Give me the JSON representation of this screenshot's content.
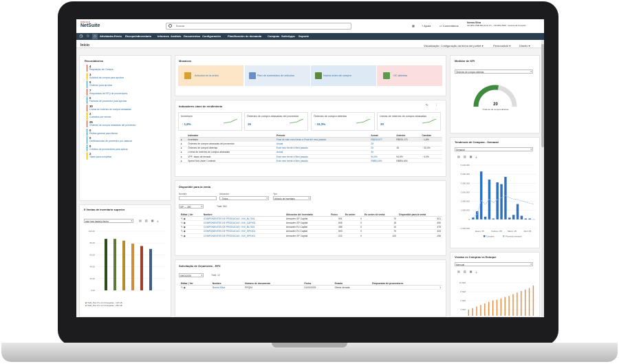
{
  "brand": {
    "oracle": "ORACLE",
    "netsuite": "NetSuite"
  },
  "search": {
    "placeholder": "Buscar"
  },
  "top_right": {
    "help": "Ajuda",
    "comments": "Comentários",
    "user_name": "Norma Silva",
    "user_detail_1": "CD MPG PRM BR (24.2) 3.5 – CD MPG PRM - Gerente de Compras"
  },
  "nav": [
    "Atividades",
    "Envio",
    "Recepción",
    "Inventario",
    "Informes",
    "Análisis",
    "Documentos",
    "Configuración",
    "Planificación de demanda",
    "Compras",
    "SuiteApps",
    "Soporte"
  ],
  "page": {
    "title": "Início",
    "view_label": "Visualização: Configuração da fecha del portlet",
    "personalize": "Personalizar",
    "layout": "Diseño"
  },
  "reminders": {
    "title": "Recordatorios",
    "items": [
      {
        "n": "4",
        "t": "Requisição de Compra",
        "c": "r"
      },
      {
        "n": "3",
        "t": "Solicitud de compra para aprobar",
        "c": "g"
      },
      {
        "n": "0",
        "t": "Órdenes para aprobar",
        "c": "b"
      },
      {
        "n": "7",
        "t": "Respuestas de RFQ de proveedores",
        "c": "r"
      },
      {
        "n": "0",
        "t": "Facturas de proveedor para aprobar",
        "c": "b"
      },
      {
        "n": "30",
        "t": "Líneas de órdenes de compra atrasadas",
        "c": "r"
      },
      {
        "n": "2",
        "t": "Contratos por vencer",
        "c": "g"
      },
      {
        "n": "25",
        "t": "Órdenes de compra atrasadas del proveedor",
        "c": "r"
      },
      {
        "n": "0",
        "t": "Pedido general para liberar",
        "c": "b"
      },
      {
        "n": "0",
        "t": "Certificaciones de proveedor por caducar",
        "c": "b"
      },
      {
        "n": "0",
        "t": "Créditos de proveedores para aplicar",
        "c": "b"
      },
      {
        "n": "2",
        "t": "Taxes para completar",
        "c": "g"
      }
    ]
  },
  "top_sales": {
    "title": "5 Ventas de inventario superior",
    "period": "este mes hasta la fecha",
    "legend": [
      "ITEM_Plan Pro 12.0 Polegadas - 128 GB",
      "ITEM_Plan Pro 12.0 Polegadas - 256 GB"
    ]
  },
  "chart_data": [
    {
      "type": "bar",
      "title": "5 Ventas de inventario superior",
      "ylim": [
        0,
        100
      ],
      "yticks": [
        "100,00",
        "80,00",
        "60,00",
        "40,00",
        "20,00",
        "0,00"
      ],
      "values": [
        87,
        87,
        84,
        79,
        75,
        70
      ],
      "colors": [
        "#2b4d1a",
        "#5a7a35",
        "#b5892e",
        "#d38b3f",
        "#9f3e2c",
        "#3d5c8a"
      ]
    },
    {
      "type": "gauge",
      "title": "Medidor de KPI",
      "selected": "Órdenes de compra abiertas",
      "value_label": "20",
      "subtitle": "Órdenes de compra abiertas",
      "fraction": 0.55
    },
    {
      "type": "bar",
      "title": "Tendencia de Compras - Semanal",
      "period": "Semanal",
      "ylim": [
        -1000000,
        6000000
      ],
      "yticks": [
        "6.000.000",
        "5.000.000",
        "4.000.000",
        "3.000.000",
        "2.000.000",
        "1.000.000",
        "0",
        "-1.000.000"
      ],
      "categories": [
        "Enero '25",
        "Febrero '25",
        "Marzo '25",
        "Abril '25"
      ],
      "values": [
        200000,
        900000,
        5300000,
        300000,
        4400000,
        100000,
        4100000,
        3900000,
        4700000,
        200000,
        500000,
        1700000,
        400000,
        100000,
        100000,
        0
      ],
      "legend": [
        "Compras",
        "Promedio semanal"
      ]
    },
    {
      "type": "bar",
      "title": "Vendas vs Compras vs Estoque",
      "period": "Mensual",
      "ylim": [
        0,
        12
      ],
      "yticks": [
        "10 MM",
        "8 MM",
        "6 MM",
        "4 MM"
      ],
      "values": [
        2,
        2.5,
        3,
        3.5,
        4,
        4.5,
        5,
        5.2,
        5.6,
        6.1,
        6.4,
        7,
        7.5,
        8,
        8.5,
        9,
        9.8
      ]
    }
  ],
  "tiles": {
    "title": "Mosaicos",
    "items": [
      "Artículos en la orden",
      "Plan de suministros de artículos",
      "Nueva orden de compra",
      "OC abiertas"
    ]
  },
  "kpis": {
    "title": "Indicadores clave de rendimiento",
    "cards": [
      {
        "label": "Inventario",
        "value": "1,8%"
      },
      {
        "label": "Órdenes de compra atrasadas del proveedor",
        "value": "25"
      },
      {
        "label": "Órdenes de compra abiertas",
        "value": "33,3%"
      },
      {
        "label": "Líneas de órdenes de compra atrasadas",
        "value": "30"
      }
    ],
    "headers": [
      "Indicador",
      "Período",
      "Actual",
      "Anterior",
      "Cambiar"
    ],
    "rows": [
      {
        "ind": "Inventario",
        "per": "Final de este mes frente a Final del mes pasado",
        "act": "R$192.677",
        "ant": "R$191.171",
        "chg": "1,8%",
        "up": true
      },
      {
        "ind": "Órdenes de compra atrasadas del proveedor",
        "per": "Actual",
        "act": "25",
        "ant": "",
        "chg": "",
        "up": false
      },
      {
        "ind": "Órdenes de compra abiertas",
        "per": "Este mes frente a Mes pasado",
        "act": "20",
        "ant": "15",
        "chg": "33,3%",
        "up": true
      },
      {
        "ind": "Líneas de órdenes de compra atrasadas",
        "per": "Actual",
        "act": "30",
        "ant": "",
        "chg": "",
        "up": false
      },
      {
        "ind": "VPF: tasas de llenado",
        "per": "Este mes frente a Mes pasado",
        "act": "94,5%",
        "ant": "94,5%",
        "chg": "0,0%",
        "up": true
      },
      {
        "ind": "Spend Not Under Contract",
        "per": "Este mes frente a Mes pasado",
        "act": "R$891.691",
        "ant": "R$891.691",
        "chg": "",
        "up": false
      }
    ]
  },
  "availability": {
    "title": "Disponible para la venta",
    "filters": [
      {
        "label": "Nombre",
        "value": ""
      },
      {
        "label": "Ubicación",
        "value": "- Todos -"
      },
      {
        "label": "Tipo",
        "value": "Artículo de inventario"
      }
    ],
    "pager": "SIP — 280",
    "total": "Total: 560",
    "headers": [
      "Editar | Ver",
      "Nombre",
      "Ubicación del inventario",
      "Físico",
      "En orden",
      "En orden de venta",
      "Disponible para la venta"
    ],
    "rows": [
      {
        "name": "COMPONENTES DE PRODUCAO : INV_BL7001",
        "loc": "Armazém SP Capital",
        "phys": "591",
        "ord": "0",
        "sale": "70",
        "avail": "521"
      },
      {
        "name": "COMPONENTES DE PRODUCAO : INV_CAP001",
        "loc": "Armazém SP Capital",
        "phys": "505",
        "ord": "0",
        "sale": "15",
        "avail": "490"
      },
      {
        "name": "COMPONENTES DE PRODUCAO : INV_BL7001",
        "loc": "Armazém RJ Capital",
        "phys": "485",
        "ord": "0",
        "sale": "10",
        "avail": "475"
      },
      {
        "name": "COMPONENTES DE PRODUCAO : INV_SPK001",
        "loc": "Armazém RJ Capital",
        "phys": "503",
        "ord": "0",
        "sale": "70",
        "avail": "433"
      },
      {
        "name": "COMPONENTES DE PRODUCAO : INV_SPK001",
        "loc": "Armazém SP Capital",
        "phys": "222",
        "ord": "0",
        "sale": "420",
        "avail": "-198"
      }
    ]
  },
  "quotes": {
    "title": "Solicitação de Orçamento - RFX",
    "date": "09/03/2025",
    "total": "Total: 12",
    "headers": [
      "Editar | Ver",
      "Nombre",
      "Número de documento",
      "Fecha",
      "Estado",
      "Respuestas de proveedores"
    ],
    "rows": [
      {
        "name": "Norma Silva",
        "doc": "RFQ04",
        "date": "01/03/2025",
        "status": "Oferta cerrada",
        "resp": "1"
      }
    ]
  }
}
